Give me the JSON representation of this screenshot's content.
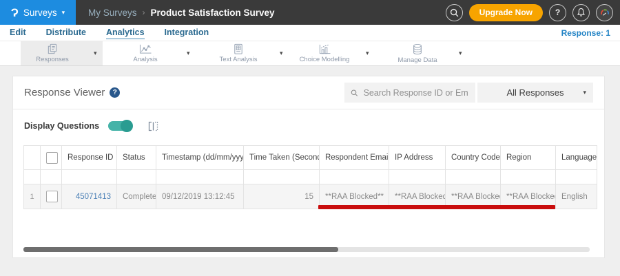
{
  "glyphs": {
    "caret_down": "▾",
    "sort_desc": "▾",
    "sort_both": "⇅"
  },
  "topbar": {
    "logo_glyph": "Ɂ",
    "app_menu_label": "Surveys",
    "breadcrumb": {
      "parent": "My Surveys",
      "separator": "›",
      "current": "Product Satisfaction Survey"
    },
    "upgrade_button": "Upgrade Now",
    "help_glyph": "?"
  },
  "nav_tabs": {
    "items": [
      {
        "label": "Edit"
      },
      {
        "label": "Distribute"
      },
      {
        "label": "Analytics"
      },
      {
        "label": "Integration"
      }
    ],
    "active": "Analytics",
    "response_count": "Response: 1"
  },
  "toolbar": {
    "items": [
      {
        "label": "Responses",
        "selected": true
      },
      {
        "label": "Analysis",
        "selected": false
      },
      {
        "label": "Text Analysis",
        "selected": false
      },
      {
        "label": "Choice Modelling",
        "selected": false
      },
      {
        "label": "Manage Data",
        "selected": false
      }
    ]
  },
  "viewer": {
    "title": "Response Viewer",
    "help_glyph": "?",
    "search_placeholder": "Search Response ID or Email",
    "responses_filter": "All Responses",
    "display_questions": "Display Questions",
    "display_questions_on": true
  },
  "table": {
    "headers": {
      "response_id": "Response ID",
      "status": "Status",
      "timestamp": "Timestamp (dd/mm/yyyy)",
      "time_taken": "Time Taken (Seconds)",
      "respondent_email": "Respondent Email",
      "ip_address": "IP Address",
      "country_code": "Country Code",
      "region": "Region",
      "language": "Language"
    },
    "row": {
      "num": "1",
      "response_id": "45071413",
      "status": "Completed",
      "timestamp": "09/12/2019 13:12:45",
      "time_taken": "15",
      "respondent_email": "**RAA Blocked**",
      "ip_address": "**RAA Blocked**",
      "country_code": "**RAA Blocked**",
      "region": "**RAA Blocked**",
      "language": "English"
    }
  },
  "colors": {
    "brand_blue": "#1d8ce0",
    "topbar_bg": "#3a3a3a",
    "upgrade_orange": "#f7a400",
    "tab_blue": "#2b6a90",
    "toggle_teal": "#45b3a8",
    "link_blue": "#4a7fb5",
    "annotation_red": "#c90d0d",
    "row_bg": "#f5f5f5"
  }
}
